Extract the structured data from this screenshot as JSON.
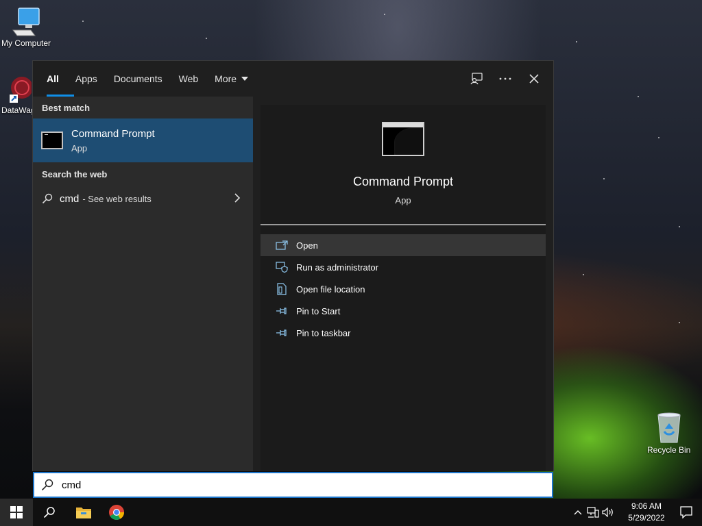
{
  "desktop": {
    "icons": [
      {
        "label": "My Computer"
      },
      {
        "label": "DataWag"
      },
      {
        "label": "Recycle Bin"
      }
    ]
  },
  "search": {
    "tabs": [
      {
        "label": "All",
        "active": true
      },
      {
        "label": "Apps"
      },
      {
        "label": "Documents"
      },
      {
        "label": "Web"
      },
      {
        "label": "More"
      }
    ],
    "best_match_heading": "Best match",
    "best_match": {
      "title": "Command Prompt",
      "subtitle": "App"
    },
    "web_heading": "Search the web",
    "web_result": {
      "query": "cmd",
      "suffix": "- See web results"
    },
    "preview": {
      "title": "Command Prompt",
      "subtitle": "App"
    },
    "actions": [
      {
        "label": "Open",
        "icon": "open-icon"
      },
      {
        "label": "Run as administrator",
        "icon": "shield-icon"
      },
      {
        "label": "Open file location",
        "icon": "file-location-icon"
      },
      {
        "label": "Pin to Start",
        "icon": "pin-icon"
      },
      {
        "label": "Pin to taskbar",
        "icon": "pin-icon"
      }
    ],
    "input_value": "cmd"
  },
  "taskbar": {
    "time": "9:06 AM",
    "date": "5/29/2022"
  },
  "colors": {
    "accent": "#0f8fe8",
    "selection": "#1e4d73"
  }
}
